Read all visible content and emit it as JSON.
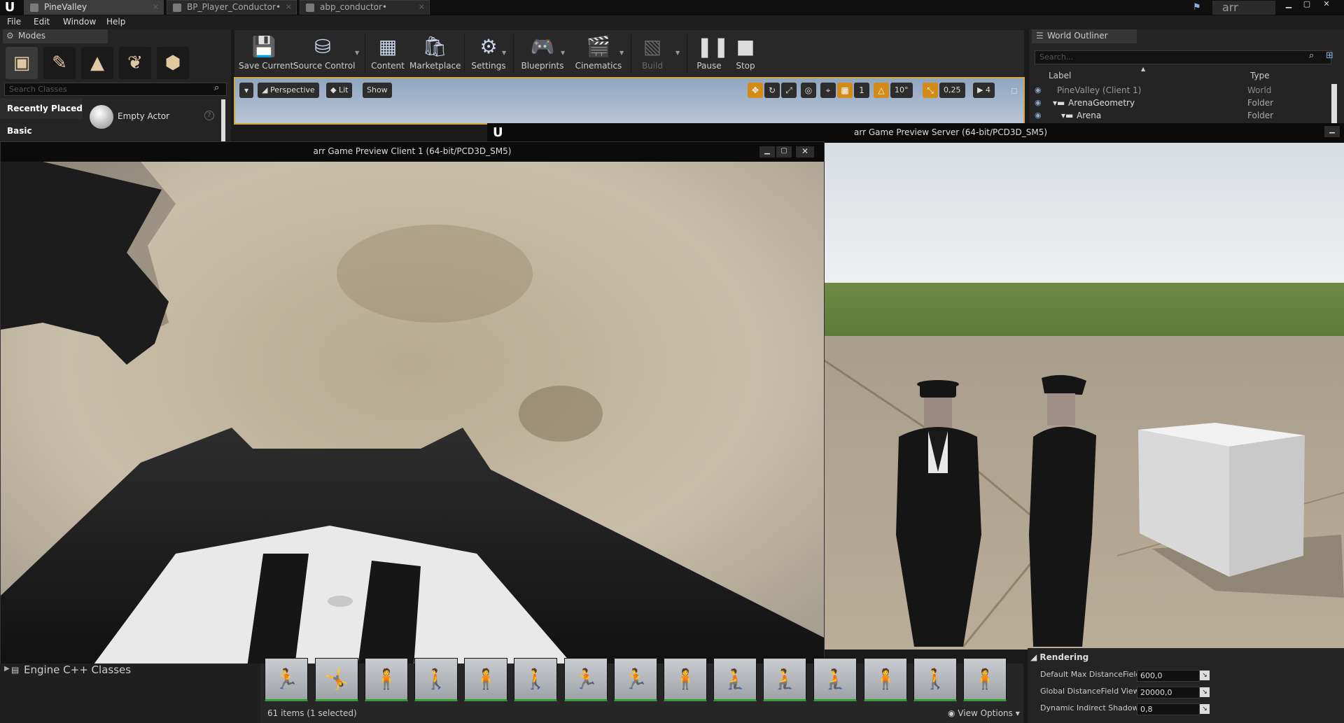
{
  "title_bar": {
    "tabs": [
      "PineValley",
      "BP_Player_Conductor•",
      "abp_conductor•"
    ],
    "project_name": "arr"
  },
  "menu": [
    "File",
    "Edit",
    "Window",
    "Help"
  ],
  "modes": {
    "tab_label": "Modes",
    "search_placeholder": "Search Classes",
    "categories": [
      "Recently Placed",
      "Basic"
    ],
    "placed_item": "Empty Actor"
  },
  "toolbar": {
    "buttons": [
      "Save Current",
      "Source Control",
      "Content",
      "Marketplace",
      "Settings",
      "Blueprints",
      "Cinematics",
      "Build",
      "Pause",
      "Stop"
    ]
  },
  "level_viewport": {
    "perspective": "Perspective",
    "lit": "Lit",
    "show": "Show",
    "grid_value": "1",
    "rotation_value": "10°",
    "scale_value": "0,25",
    "camera_speed": "4"
  },
  "outliner": {
    "tab_label": "World Outliner",
    "search_placeholder": "Search...",
    "col_label": "Label",
    "col_type": "Type",
    "rows": [
      {
        "label": "PineValley (Client 1)",
        "type": "World"
      },
      {
        "label": "ArenaGeometry",
        "type": "Folder"
      },
      {
        "label": "Arena",
        "type": "Folder"
      }
    ]
  },
  "server_window": {
    "title": "arr Game Preview Server (64-bit/PCD3D_SM5)"
  },
  "client_window": {
    "title": "arr Game Preview Client 1 (64-bit/PCD3D_SM5)"
  },
  "content_browser": {
    "tree_item": "Engine C++ Classes",
    "item_count": "61 items (1 selected)",
    "view_options": "View Options"
  },
  "details": {
    "section": "Rendering",
    "rows": [
      {
        "label": "Default Max DistanceField",
        "value": "600,0"
      },
      {
        "label": "Global DistanceField View I",
        "value": "20000,0"
      },
      {
        "label": "Dynamic Indirect Shadows",
        "value": "0,8"
      }
    ]
  },
  "colors": {
    "accent_orange": "#d28a19",
    "thumb_border_green": "#2d9f34",
    "editor_bg": "#242424"
  }
}
